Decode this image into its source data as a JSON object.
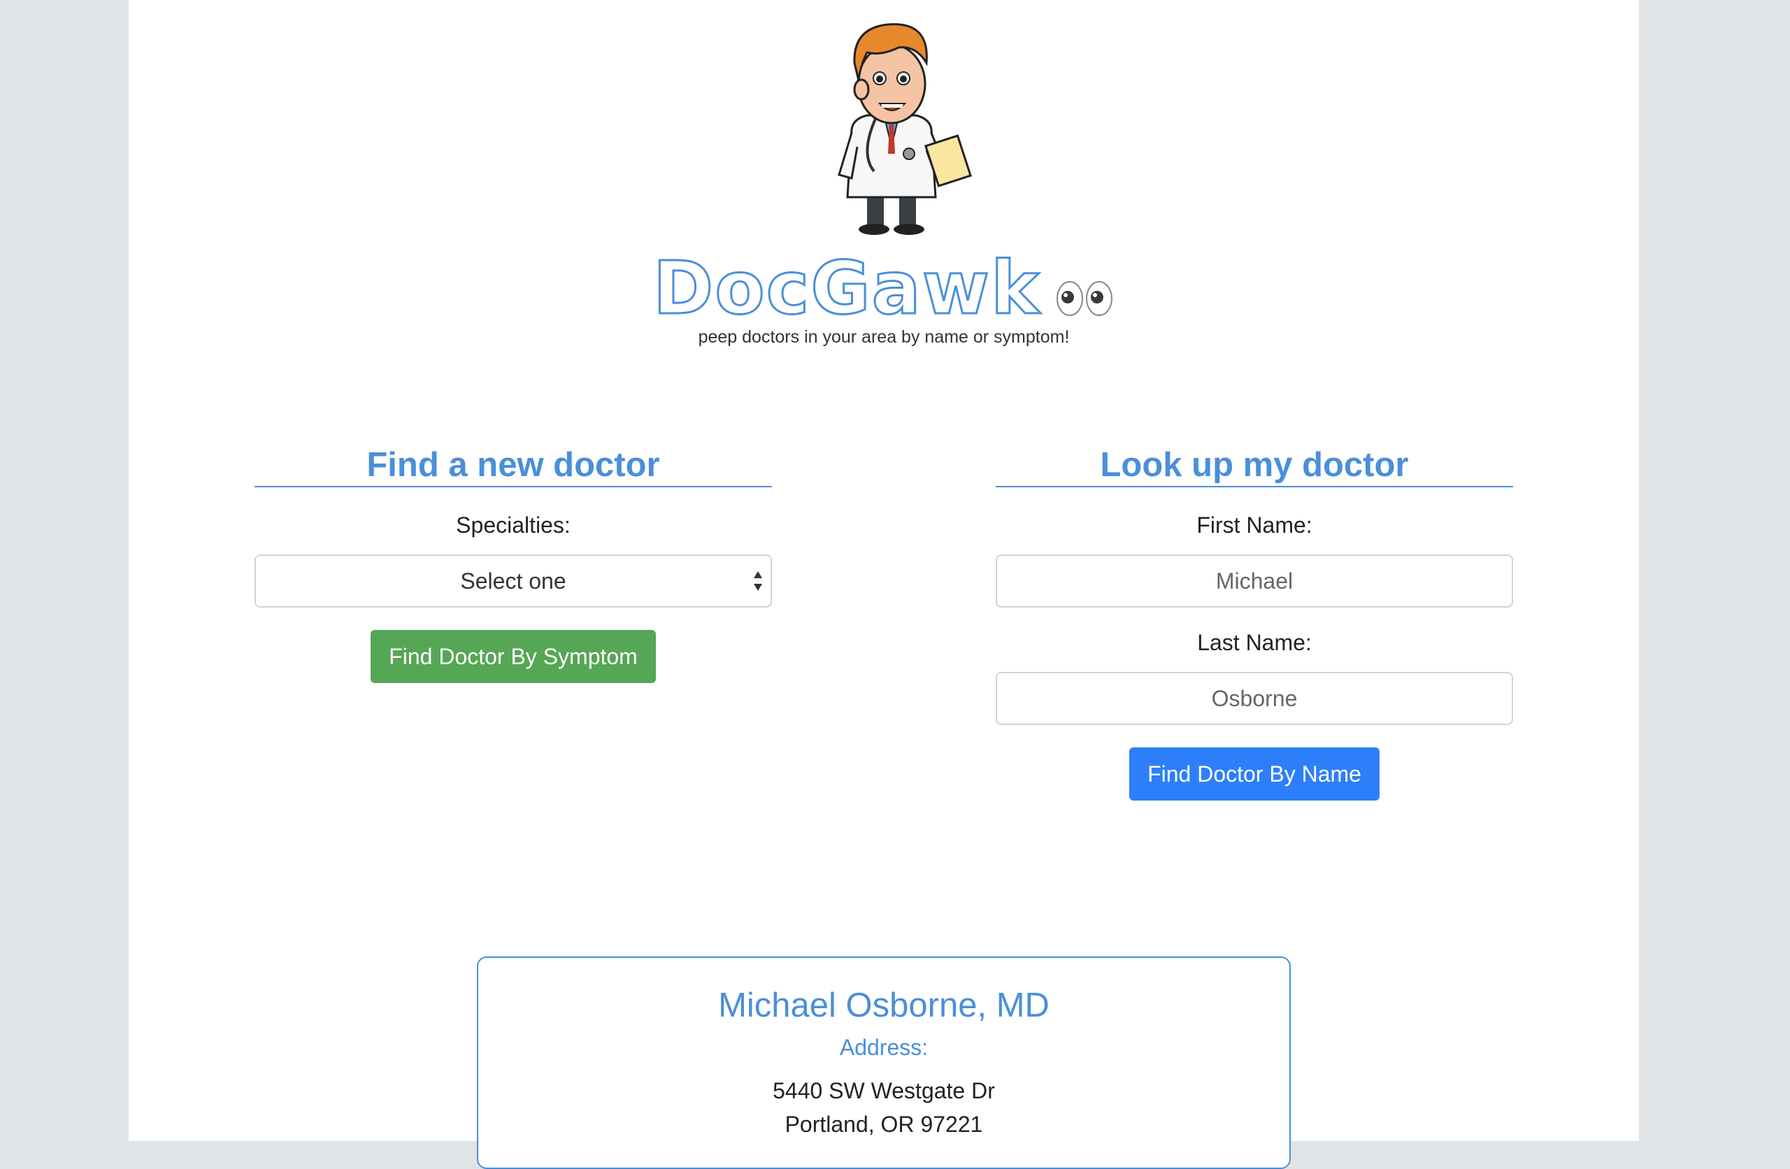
{
  "app": {
    "logo_text": "DocGawk",
    "tagline": "peep doctors in your area by name or symptom!"
  },
  "find_new": {
    "title": "Find a new doctor",
    "specialties_label": "Specialties:",
    "select_value": "Select one",
    "button_label": "Find Doctor By Symptom"
  },
  "lookup": {
    "title": "Look up my doctor",
    "first_name_label": "First Name:",
    "first_name_value": "Michael",
    "last_name_label": "Last Name:",
    "last_name_value": "Osborne",
    "button_label": "Find Doctor By Name"
  },
  "result": {
    "name": "Michael Osborne, MD",
    "address_label": "Address:",
    "address_line1": "5440 SW Westgate Dr",
    "address_line2": "Portland, OR 97221"
  },
  "icons": {
    "mascot": "doctor-mascot-icon",
    "eyes": "eyes-emoji-icon",
    "select_arrows": "select-arrows-icon"
  },
  "colors": {
    "accent": "#4a8fd9",
    "green_button": "#55a655",
    "blue_button": "#2d7ff9",
    "background": "#e0e4e7"
  }
}
